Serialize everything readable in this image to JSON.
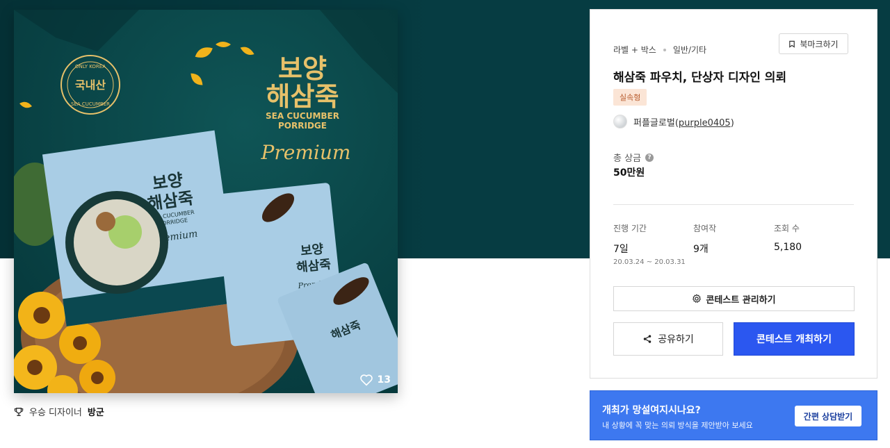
{
  "product": {
    "brand_text": "보양\n해삼죽",
    "brand_line1": "보양",
    "brand_line2": "해삼죽",
    "english_line1": "SEA CUCUMBER",
    "english_line2": "PORRIDGE",
    "premium_text": "Premium",
    "seal_center": "국내산",
    "seal_top": "ONLY KOREA",
    "seal_bottom": "SEA CUCUMBER",
    "likes": "13"
  },
  "award": {
    "label": "우승 디자이너",
    "designer": "방군"
  },
  "contest": {
    "category": "라벨 + 박스",
    "subcategory": "일반/기타",
    "bookmark_label": "북마크하기",
    "title": "해삼죽 파우치, 단상자 디자인 의뢰",
    "badge": "실속형",
    "host_name": "퍼플글로벌",
    "host_id": "purple0405",
    "prize_label": "총 상금",
    "prize_value": "50만원",
    "stats": [
      {
        "label": "진행 기간",
        "value": "7일",
        "sub": "20.03.24 ~ 20.03.31"
      },
      {
        "label": "참여작",
        "value": "9개",
        "sub": ""
      },
      {
        "label": "조회 수",
        "value": "5,180",
        "sub": ""
      }
    ],
    "manage_label": "콘테스트 관리하기",
    "share_label": "공유하기",
    "host_contest_label": "콘테스트 개최하기"
  },
  "help": {
    "title": "개최가 망설여지시나요?",
    "subtitle": "내 상황에 꼭 맞는 의뢰 방식을 제안받아 보세요",
    "button": "간편 상담받기"
  },
  "colors": {
    "hero": "#063c42",
    "primary": "#2b57f0",
    "banner": "#3d78f0",
    "badge_bg": "#fbe5d6",
    "gold": "#e7c16a"
  }
}
